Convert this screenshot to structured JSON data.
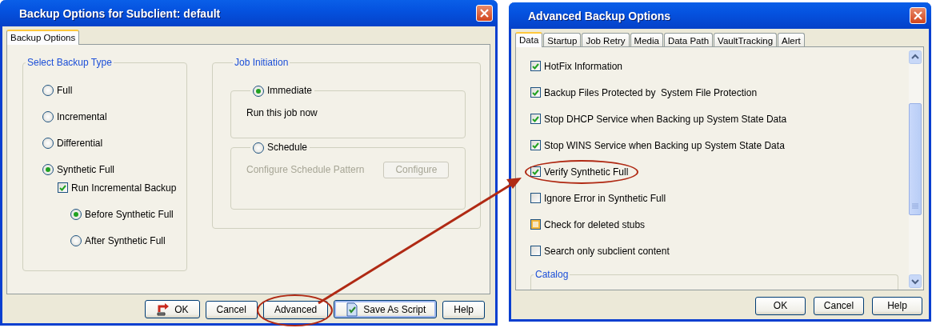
{
  "backup_window": {
    "title": "Backup Options for Subclient: default",
    "tabs": [
      {
        "label": "Backup Options",
        "selected": true
      }
    ],
    "backup_type": {
      "title": "Select Backup Type",
      "options": [
        {
          "kind": "radio",
          "label": "Full",
          "selected": false
        },
        {
          "kind": "radio",
          "label": "Incremental",
          "selected": false
        },
        {
          "kind": "radio",
          "label": "Differential",
          "selected": false
        },
        {
          "kind": "radio",
          "label": "Synthetic Full",
          "selected": true,
          "children": [
            {
              "kind": "checkbox",
              "label": "Run Incremental Backup",
              "checked": true,
              "children": [
                {
                  "kind": "radio",
                  "label": "Before Synthetic Full",
                  "selected": true
                },
                {
                  "kind": "radio",
                  "label": "After Synthetic Full",
                  "selected": false
                }
              ]
            }
          ]
        }
      ]
    },
    "job_initiation": {
      "title": "Job Initiation",
      "options": [
        {
          "label": "Immediate",
          "selected": true,
          "text": "Run this job now",
          "disabled": false
        },
        {
          "label": "Schedule",
          "selected": false,
          "text": "Configure Schedule Pattern",
          "button": "Configure",
          "disabled": true
        }
      ]
    },
    "buttons": [
      {
        "kind": "ok",
        "label": "OK",
        "default": false,
        "circled": false
      },
      {
        "kind": "plain",
        "label": "Cancel",
        "default": false,
        "circled": false
      },
      {
        "kind": "plain",
        "label": "Advanced",
        "default": false,
        "circled": true
      },
      {
        "kind": "script",
        "label": "Save As Script",
        "default": true,
        "circled": false
      },
      {
        "kind": "plain",
        "label": "Help",
        "default": false,
        "circled": false
      }
    ]
  },
  "advanced_window": {
    "title": "Advanced Backup Options",
    "tabs": [
      {
        "label": "Data",
        "selected": true
      },
      {
        "label": "Startup",
        "selected": false
      },
      {
        "label": "Job Retry",
        "selected": false
      },
      {
        "label": "Media",
        "selected": false
      },
      {
        "label": "Data Path",
        "selected": false
      },
      {
        "label": "VaultTracking",
        "selected": false
      },
      {
        "label": "Alert",
        "selected": false
      }
    ],
    "options": [
      {
        "kind": "plain",
        "label": "HotFix Information",
        "checked": true,
        "circled": false
      },
      {
        "kind": "plain",
        "label": "Backup Files Protected by  System File Protection",
        "checked": true,
        "circled": false
      },
      {
        "kind": "plain",
        "label": "Stop DHCP Service when Backing up System State Data",
        "checked": true,
        "circled": false
      },
      {
        "kind": "plain",
        "label": "Stop WINS Service when Backing up System State Data",
        "checked": true,
        "circled": false
      },
      {
        "kind": "plain",
        "label": "Verify Synthetic Full",
        "checked": true,
        "circled": true
      },
      {
        "kind": "plain",
        "label": "Ignore Error in Synthetic Full",
        "checked": false,
        "circled": false
      },
      {
        "kind": "hover",
        "label": "Check for deleted stubs",
        "checked": false,
        "circled": false
      },
      {
        "kind": "plain",
        "label": "Search only subclient content",
        "checked": false,
        "circled": false
      }
    ],
    "group_title": "Catalog",
    "buttons": [
      {
        "label": "OK"
      },
      {
        "label": "Cancel"
      },
      {
        "label": "Help"
      }
    ]
  }
}
